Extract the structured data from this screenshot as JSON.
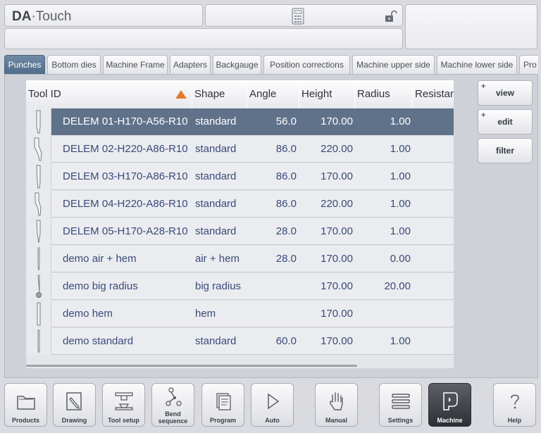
{
  "header": {
    "logo_bold": "DA",
    "logo_rest": "·Touch"
  },
  "tabs": [
    {
      "label": "Punches",
      "active": true
    },
    {
      "label": "Bottom dies"
    },
    {
      "label": "Machine Frame"
    },
    {
      "label": "Adapters"
    },
    {
      "label": "Backgauge"
    },
    {
      "label": "Position corrections"
    },
    {
      "label": "Machine upper side"
    },
    {
      "label": "Machine lower side"
    },
    {
      "label": "Pro"
    }
  ],
  "table": {
    "columns": [
      "Tool ID",
      "Shape",
      "Angle",
      "Height",
      "Radius",
      "Resistan"
    ],
    "rows": [
      {
        "id": "DELEM 01-H170-A56-R10",
        "shape": "standard",
        "angle": "56.0",
        "height": "170.00",
        "radius": "1.00"
      },
      {
        "id": "DELEM 02-H220-A86-R10",
        "shape": "standard",
        "angle": "86.0",
        "height": "220.00",
        "radius": "1.00"
      },
      {
        "id": "DELEM 03-H170-A86-R10",
        "shape": "standard",
        "angle": "86.0",
        "height": "170.00",
        "radius": "1.00"
      },
      {
        "id": "DELEM 04-H220-A86-R10",
        "shape": "standard",
        "angle": "86.0",
        "height": "220.00",
        "radius": "1.00"
      },
      {
        "id": "DELEM 05-H170-A28-R10",
        "shape": "standard",
        "angle": "28.0",
        "height": "170.00",
        "radius": "1.00"
      },
      {
        "id": "demo air + hem",
        "shape": "air + hem",
        "angle": "28.0",
        "height": "170.00",
        "radius": "0.00"
      },
      {
        "id": "demo big radius",
        "shape": "big radius",
        "angle": "",
        "height": "170.00",
        "radius": "20.00"
      },
      {
        "id": "demo hem",
        "shape": "hem",
        "angle": "",
        "height": "170.00",
        "radius": ""
      },
      {
        "id": "demo standard",
        "shape": "standard",
        "angle": "60.0",
        "height": "170.00",
        "radius": "1.00"
      }
    ]
  },
  "side_buttons": {
    "view": "view",
    "edit": "edit",
    "filter": "filter",
    "plus": "+"
  },
  "nav": {
    "products": "Products",
    "drawing": "Drawing",
    "tool_setup": "Tool setup",
    "bend_sequence_1": "Bend",
    "bend_sequence_2": "sequence",
    "program": "Program",
    "auto": "Auto",
    "manual": "Manual",
    "settings": "Settings",
    "machine": "Machine",
    "help": "Help"
  },
  "colors": {
    "active_tab": "#5b7797",
    "selected_row": "#60728a",
    "accent_sort": "#e07b2e"
  }
}
